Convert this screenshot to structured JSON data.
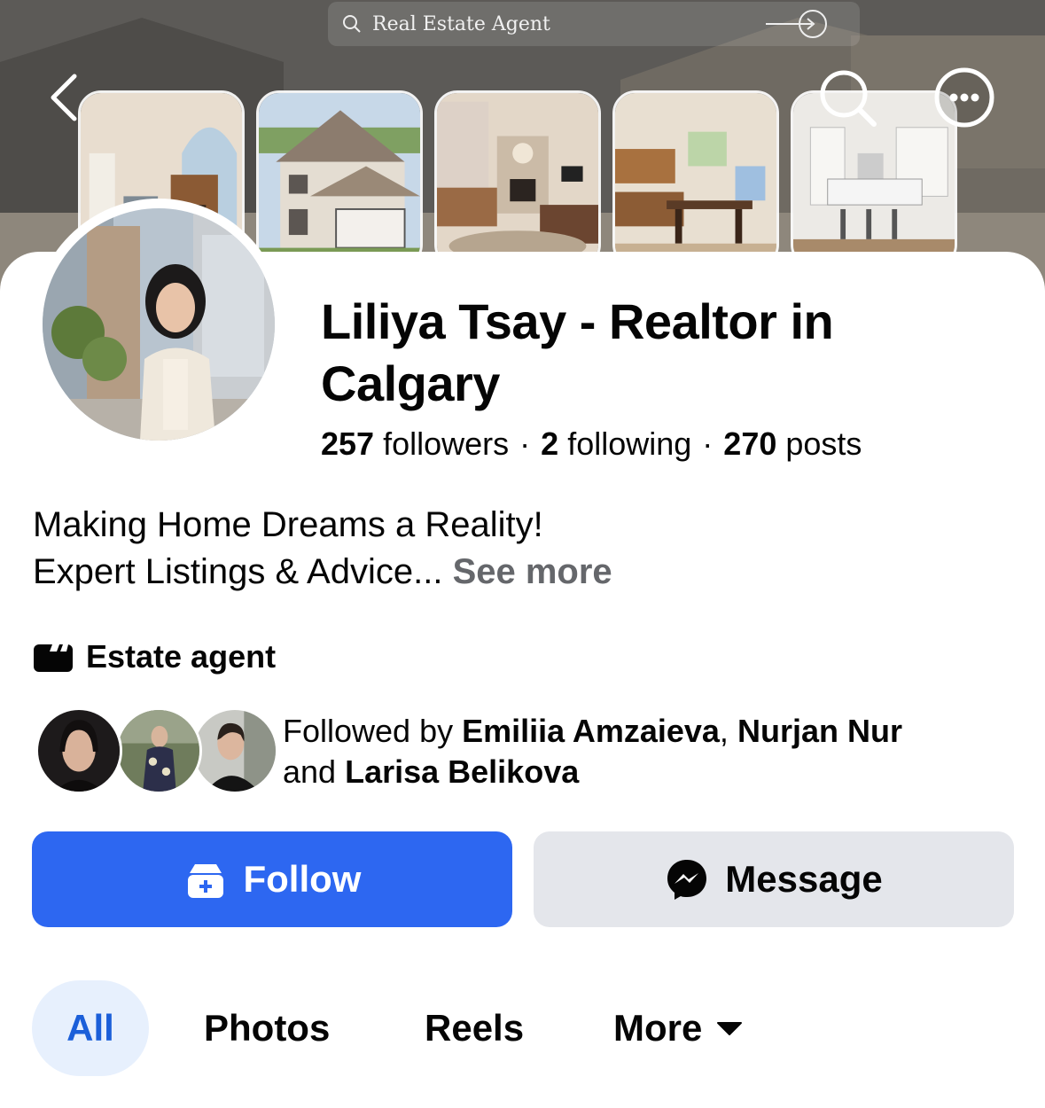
{
  "cover": {
    "search_text": "Real Estate Agent",
    "icons": [
      "back-icon",
      "search-icon",
      "more-icon"
    ]
  },
  "profile": {
    "name": "Liliya Tsay - Realtor in Calgary",
    "followers_count": "257",
    "followers_label": "followers",
    "following_count": "2",
    "following_label": "following",
    "posts_count": "270",
    "posts_label": "posts",
    "separator": "·",
    "bio_line1": "Making Home Dreams a Reality!",
    "bio_line2": "Expert Listings & Advice...",
    "see_more": "See more",
    "category": "Estate agent"
  },
  "followed_by": {
    "prefix": "Followed by",
    "name1": "Emiliia Amzaieva",
    "comma": ",",
    "name2": "Nurjan Nur",
    "conjunction": "and",
    "name3": "Larisa Belikova"
  },
  "actions": {
    "follow_label": "Follow",
    "message_label": "Message"
  },
  "tabs": [
    {
      "label": "All",
      "selected": true
    },
    {
      "label": "Photos",
      "selected": false
    },
    {
      "label": "Reels",
      "selected": false
    },
    {
      "label": "More",
      "selected": false
    }
  ],
  "colors": {
    "follow_button": "#2d67f1",
    "message_button": "#e4e6eb",
    "tab_selected_bg": "#e7f0fd",
    "tab_selected_text": "#1b5fd9",
    "see_more": "#65676b"
  }
}
